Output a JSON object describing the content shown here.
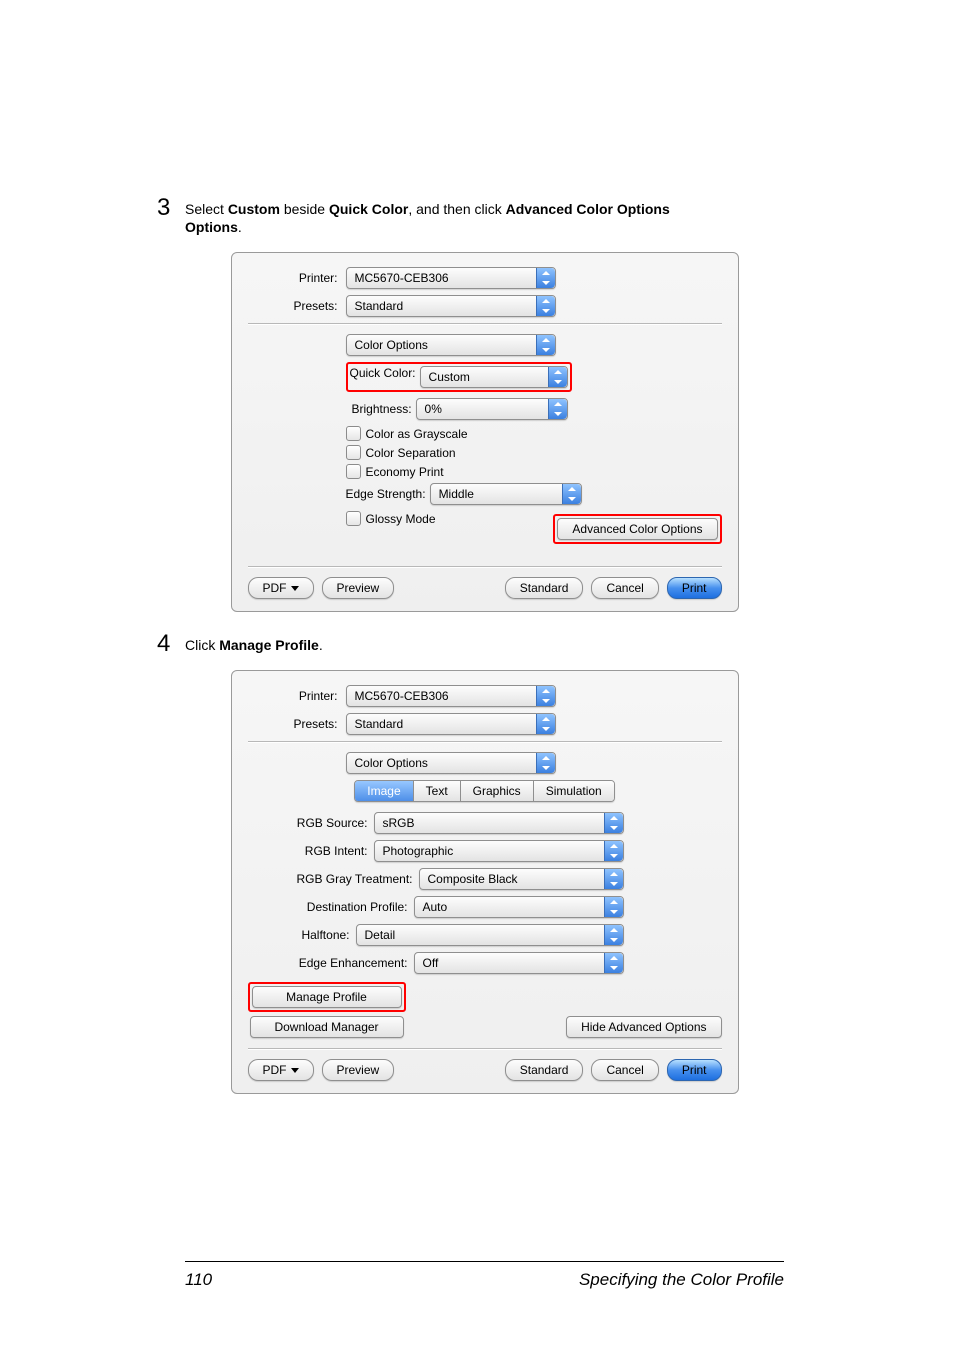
{
  "step3": {
    "number": "3",
    "text_before": "Select ",
    "bold1": "Custom",
    "text_mid1": " beside ",
    "bold2": "Quick Color",
    "text_mid2": ", and then click ",
    "bold3": "Advanced Color Options",
    "text_end": "."
  },
  "dialog1": {
    "printer_label": "Printer:",
    "printer_value": "MC5670-CEB306",
    "presets_label": "Presets:",
    "presets_value": "Standard",
    "section_select": "Color Options",
    "quick_color_label": "Quick Color:",
    "quick_color_value": "Custom",
    "brightness_label": "Brightness:",
    "brightness_value": "0%",
    "cb_grayscale": "Color as Grayscale",
    "cb_separation": "Color Separation",
    "cb_economy": "Economy Print",
    "edge_label": "Edge Strength:",
    "edge_value": "Middle",
    "cb_glossy": "Glossy Mode",
    "advanced_btn": "Advanced Color Options",
    "pdf": "PDF",
    "preview": "Preview",
    "standard": "Standard",
    "cancel": "Cancel",
    "print": "Print"
  },
  "step4": {
    "number": "4",
    "text_before": "Click ",
    "bold1": "Manage Profile",
    "text_end": "."
  },
  "dialog2": {
    "printer_label": "Printer:",
    "printer_value": "MC5670-CEB306",
    "presets_label": "Presets:",
    "presets_value": "Standard",
    "section_select": "Color Options",
    "tabs": {
      "image": "Image",
      "text": "Text",
      "graphics": "Graphics",
      "simulation": "Simulation"
    },
    "rgb_source_label": "RGB Source:",
    "rgb_source_value": "sRGB",
    "rgb_intent_label": "RGB Intent:",
    "rgb_intent_value": "Photographic",
    "rgb_gray_label": "RGB Gray Treatment:",
    "rgb_gray_value": "Composite Black",
    "dest_label": "Destination Profile:",
    "dest_value": "Auto",
    "halftone_label": "Halftone:",
    "halftone_value": "Detail",
    "edge_enh_label": "Edge Enhancement:",
    "edge_enh_value": "Off",
    "manage_profile": "Manage Profile",
    "download_manager": "Download Manager",
    "hide_adv": "Hide Advanced Options",
    "pdf": "PDF",
    "preview": "Preview",
    "standard": "Standard",
    "cancel": "Cancel",
    "print": "Print"
  },
  "footer": {
    "page_number": "110",
    "section_title": "Specifying the Color Profile"
  }
}
